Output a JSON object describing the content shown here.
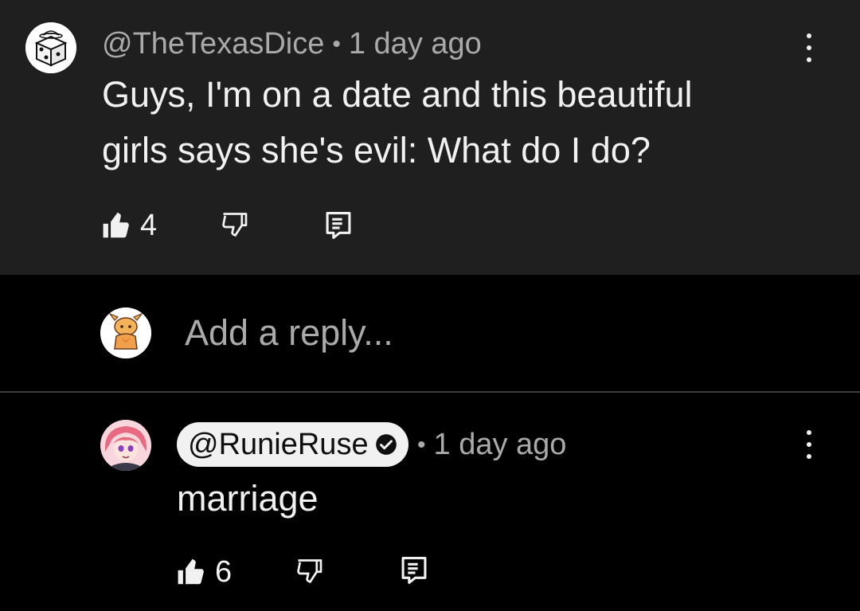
{
  "comment": {
    "handle": "@TheTexasDice",
    "separator": "•",
    "time": "1 day ago",
    "text_line1": "Guys, I'm on a date and this beautiful",
    "text_line2": "girls says she's evil: What do I do?",
    "like_count": "4"
  },
  "reply_box": {
    "placeholder": "Add a reply..."
  },
  "reply": {
    "handle": "@RunieRuse",
    "separator": "•",
    "time": "1 day ago",
    "text": "marriage",
    "like_count": "6"
  },
  "colors": {
    "parent_bg": "#1f1f1f",
    "page_bg": "#000000",
    "secondary_text": "#aaaaaa",
    "primary_text": "#f1f1f1",
    "chip_bg": "#f1f1f1"
  },
  "icons": [
    "dice-avatar-icon",
    "kebab-menu-icon",
    "thumbs-up-filled-icon",
    "thumbs-down-icon",
    "reply-icon",
    "verified-check-icon"
  ]
}
